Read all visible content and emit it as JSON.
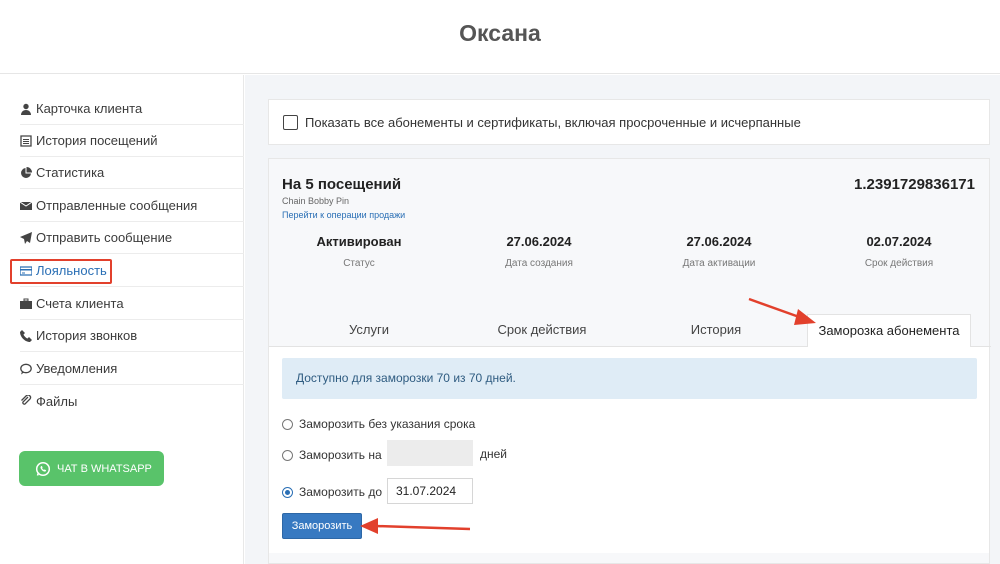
{
  "header": {
    "title": "Оксана"
  },
  "sidebar": {
    "items": [
      {
        "label": "Карточка клиента",
        "icon": "user-icon"
      },
      {
        "label": "История посещений",
        "icon": "list-icon"
      },
      {
        "label": "Статистика",
        "icon": "pie-chart-icon"
      },
      {
        "label": "Отправленные сообщения",
        "icon": "envelope-icon"
      },
      {
        "label": "Отправить сообщение",
        "icon": "send-icon"
      },
      {
        "label": "Лояльность",
        "icon": "credit-card-icon"
      },
      {
        "label": "Счета клиента",
        "icon": "briefcase-icon"
      },
      {
        "label": "История звонков",
        "icon": "phone-icon"
      },
      {
        "label": "Уведомления",
        "icon": "comment-icon"
      },
      {
        "label": "Файлы",
        "icon": "paperclip-icon"
      }
    ],
    "active_item": "Лояльность",
    "whatsapp_label": "ЧАТ В WHATSAPP"
  },
  "filter": {
    "label": "Показать все абонементы и сертификаты, включая просроченные и исчерпанные",
    "checked": false
  },
  "card": {
    "title": "На 5 посещений",
    "subtitle": "Chain Bobby Pin",
    "link": "Перейти к операции продажи",
    "number": "1.2391729836171",
    "stats": [
      {
        "value": "Активирован",
        "label": "Статус"
      },
      {
        "value": "27.06.2024",
        "label": "Дата создания"
      },
      {
        "value": "27.06.2024",
        "label": "Дата активации"
      },
      {
        "value": "02.07.2024",
        "label": "Срок действия"
      }
    ],
    "tabs": [
      "Услуги",
      "Срок действия",
      "История",
      "Заморозка абонемента"
    ],
    "active_tab": "Заморозка абонемента"
  },
  "freeze": {
    "info": "Доступно для заморозки 70 из 70 дней.",
    "option_indefinite": "Заморозить без указания срока",
    "option_days": "Заморозить на",
    "days_value": "",
    "days_unit": "дней",
    "option_until": "Заморозить до",
    "date_value": "31.07.2024",
    "selected_option": "option_until",
    "button": "Заморозить"
  },
  "colors": {
    "accent": "#2a6fb5",
    "annotation_red": "#e2402c",
    "whatsapp_green": "#59c36a",
    "info_bg": "#dfecf6"
  }
}
